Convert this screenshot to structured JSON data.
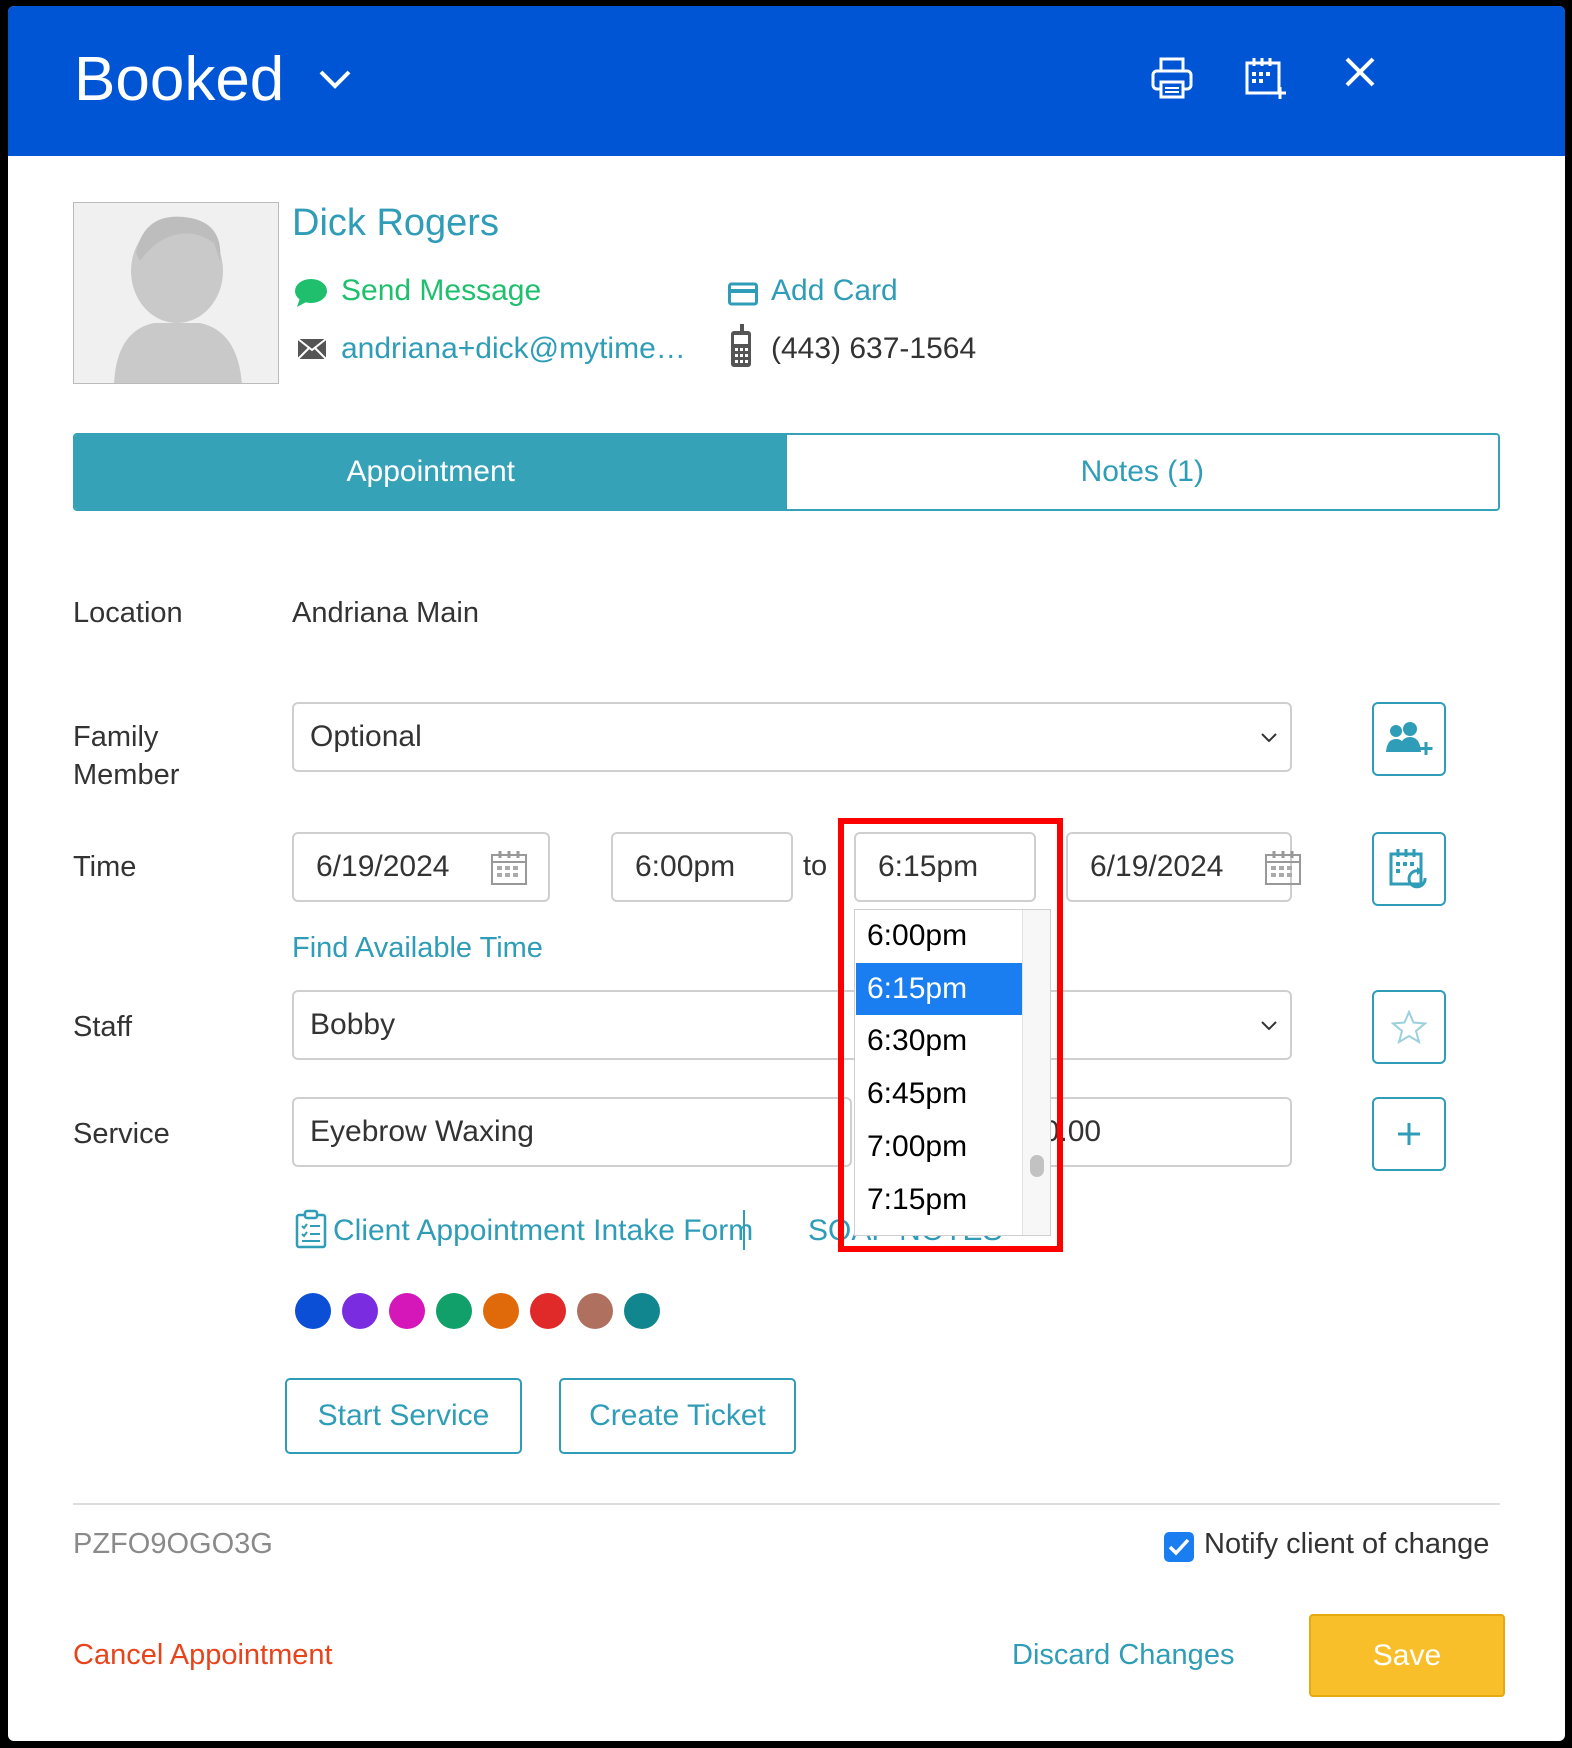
{
  "header": {
    "title": "Booked"
  },
  "client": {
    "name": "Dick Rogers",
    "send_message": "Send Message",
    "add_card": "Add Card",
    "email": "andriana+dick@mytime…",
    "phone": "(443) 637-1564"
  },
  "tabs": [
    {
      "label": "Appointment",
      "active": true
    },
    {
      "label": "Notes (1)",
      "active": false
    }
  ],
  "form": {
    "location_label": "Location",
    "location_value": "Andriana Main",
    "family_label_1": "Family",
    "family_label_2": "Member",
    "family_value": "Optional",
    "time_label": "Time",
    "start_date": "6/19/2024",
    "start_time": "6:00pm",
    "to": "to",
    "end_time": "6:15pm",
    "end_date": "6/19/2024",
    "find_time": "Find Available Time",
    "staff_label": "Staff",
    "staff_value": "Bobby",
    "service_label": "Service",
    "service_value": "Eyebrow Waxing",
    "price_value": "40.00",
    "intake_form": "Client Appointment Intake Form",
    "soap_notes": "SOAP NOTES"
  },
  "time_dropdown": {
    "options": [
      "6:00pm",
      "6:15pm",
      "6:30pm",
      "6:45pm",
      "7:00pm",
      "7:15pm"
    ],
    "selected": "6:15pm"
  },
  "colors": [
    "#0a4fd6",
    "#7a2de0",
    "#d516b8",
    "#12a06a",
    "#e06a0a",
    "#e02a2a",
    "#b07060",
    "#12868e"
  ],
  "actions": {
    "start_service": "Start Service",
    "create_ticket": "Create Ticket",
    "booking_code": "PZFO9OGO3G",
    "notify": "Notify client of change",
    "notify_checked": true,
    "cancel": "Cancel Appointment",
    "discard": "Discard Changes",
    "save": "Save"
  }
}
